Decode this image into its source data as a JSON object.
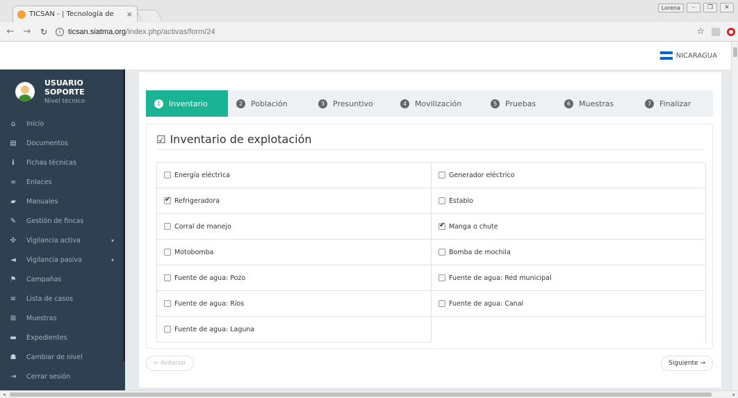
{
  "browser": {
    "tab_title": "TICSAN - | Tecnología de",
    "tab_close": "×",
    "user_label": "Lorena",
    "url_domain": "ticsan.siatma.org",
    "url_path": "/index.php/activas/form/24"
  },
  "header": {
    "country": "NICARAGUA",
    "flag_colors": [
      "#0067c6",
      "#ffffff",
      "#0067c6"
    ]
  },
  "sidebar": {
    "user_name": "USUARIO SOPORTE",
    "user_level": "Nivel técnico",
    "items": [
      {
        "label": "Inicio",
        "icon": "home-icon",
        "glyph": "⌂"
      },
      {
        "label": "Documentos",
        "icon": "document-icon",
        "glyph": "▤"
      },
      {
        "label": "Fichas técnicas",
        "icon": "info-icon",
        "glyph": "ℹ"
      },
      {
        "label": "Enlaces",
        "icon": "link-icon",
        "glyph": "∞"
      },
      {
        "label": "Manuales",
        "icon": "book-icon",
        "glyph": "▰"
      },
      {
        "label": "Gestión de fincas",
        "icon": "edit-icon",
        "glyph": "✎"
      },
      {
        "label": "Vigilancia activa",
        "icon": "paw-icon",
        "glyph": "✣",
        "caret": "▾"
      },
      {
        "label": "Vigilancia pasiva",
        "icon": "bullhorn-icon",
        "glyph": "◄",
        "caret": "▾"
      },
      {
        "label": "Campañas",
        "icon": "flag-icon",
        "glyph": "⚑"
      },
      {
        "label": "Lista de casos",
        "icon": "list-icon",
        "glyph": "≡"
      },
      {
        "label": "Muestras",
        "icon": "grid-icon",
        "glyph": "⊞"
      },
      {
        "label": "Expedientes",
        "icon": "folder-icon",
        "glyph": "▬"
      },
      {
        "label": "Cambiar de nivel",
        "icon": "users-icon",
        "glyph": "☗"
      },
      {
        "label": "Cerrar sesión",
        "icon": "sign-out-icon",
        "glyph": "⇥"
      }
    ]
  },
  "wizard": {
    "steps": [
      {
        "num": "1",
        "label": "Inventario",
        "active": true
      },
      {
        "num": "2",
        "label": "Población"
      },
      {
        "num": "3",
        "label": "Presuntivo"
      },
      {
        "num": "4",
        "label": "Movilización"
      },
      {
        "num": "5",
        "label": "Pruebas"
      },
      {
        "num": "6",
        "label": "Muestras"
      },
      {
        "num": "7",
        "label": "Finalizar"
      }
    ]
  },
  "form": {
    "title": "Inventario de explotación",
    "items": [
      {
        "label": "Energía eléctrica",
        "checked": false
      },
      {
        "label": "Generador eléctrico",
        "checked": false
      },
      {
        "label": "Refrigeradora",
        "checked": true
      },
      {
        "label": "Establo",
        "checked": false
      },
      {
        "label": "Corral de manejo",
        "checked": false
      },
      {
        "label": "Manga o chute",
        "checked": true
      },
      {
        "label": "Motobomba",
        "checked": false
      },
      {
        "label": "Bomba de mochila",
        "checked": false
      },
      {
        "label": "Fuente de agua: Pozo",
        "checked": false
      },
      {
        "label": "Fuente de agua: Red municipal",
        "checked": false
      },
      {
        "label": "Fuente de agua: Ríos",
        "checked": false
      },
      {
        "label": "Fuente de agua: Canal",
        "checked": false
      },
      {
        "label": "Fuente de agua: Laguna",
        "checked": false
      }
    ]
  },
  "pager": {
    "prev": "← Anterior",
    "next": "Siguiente →"
  },
  "colors": {
    "accent": "#1ab394",
    "sidebar_bg": "#2f4050"
  }
}
